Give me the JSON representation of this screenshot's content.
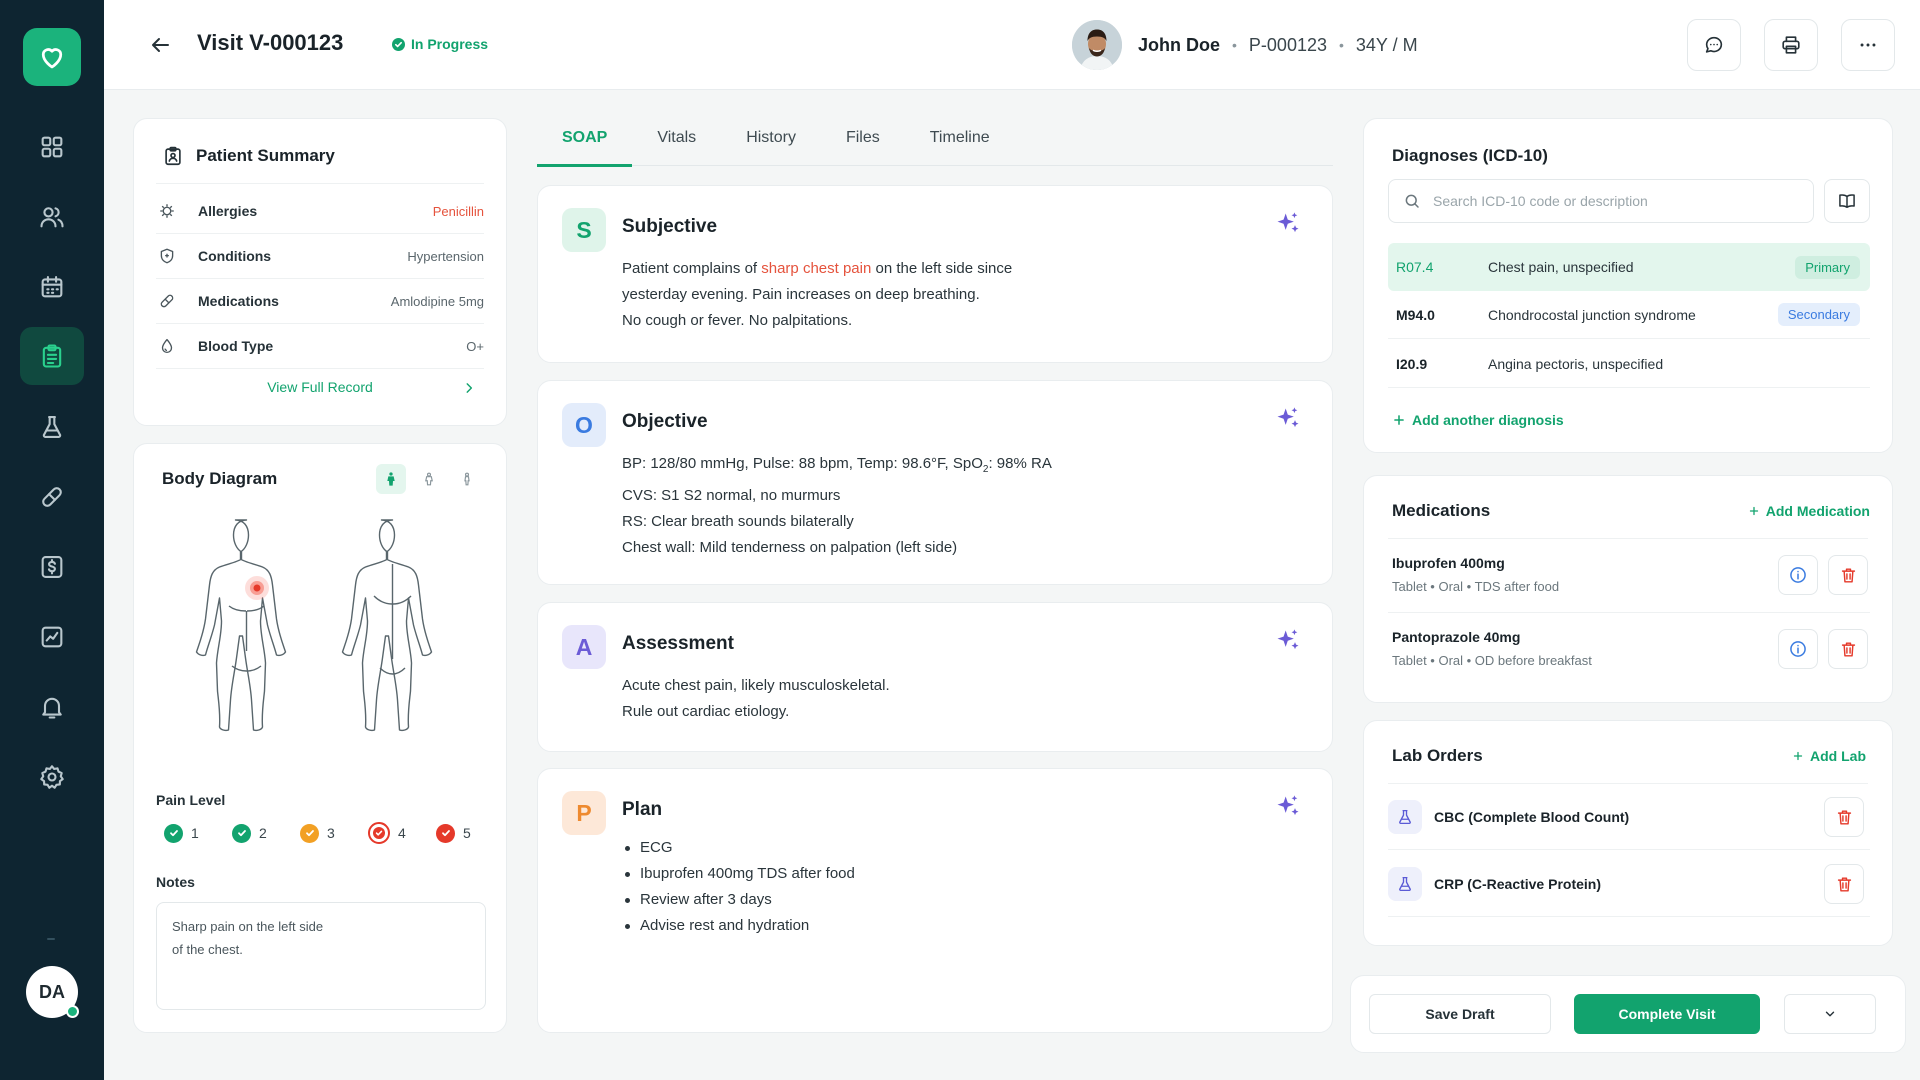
{
  "header": {
    "visit_title": "Visit V-000123",
    "status": "In Progress",
    "patient_name": "John Doe",
    "patient_id": "P-000123",
    "patient_age_sex": "34Y / M",
    "separator": "•"
  },
  "patient_summary": {
    "title": "Patient Summary",
    "rows": [
      {
        "label": "Allergies",
        "value": "Penicillin"
      },
      {
        "label": "Conditions",
        "value": "Hypertension"
      },
      {
        "label": "Medications",
        "value": "Amlodipine 5mg"
      },
      {
        "label": "Blood Type",
        "value": "O+"
      }
    ],
    "view_full": "View Full Record"
  },
  "body_diagram": {
    "title": "Body Diagram",
    "pain_title": "Pain Level",
    "pain_levels": [
      "1",
      "2",
      "3",
      "4",
      "5"
    ],
    "selected_pain": "4",
    "notes_title": "Notes",
    "notes": "Sharp pain on the left side\nof the chest."
  },
  "tabs": [
    "SOAP",
    "Vitals",
    "History",
    "Files",
    "Timeline"
  ],
  "active_tab": "SOAP",
  "soap": {
    "subjective": {
      "letter": "S",
      "title": "Subjective",
      "pre": "Patient complains of ",
      "highlight": "sharp chest pain",
      "post": " on the left side since",
      "line2": "yesterday evening. Pain increases on deep breathing.",
      "line3": "No cough or fever. No palpitations."
    },
    "objective": {
      "letter": "O",
      "title": "Objective",
      "vitals_pre": "BP: 128/80 mmHg, Pulse: 88 bpm, Temp: 98.6°F, SpO",
      "vitals_sub": "2",
      "vitals_post": ": 98% RA",
      "line2": "CVS: S1 S2 normal, no murmurs",
      "line3": "RS: Clear breath sounds bilaterally",
      "line4": "Chest wall: Mild tenderness on palpation (left side)"
    },
    "assessment": {
      "letter": "A",
      "title": "Assessment",
      "line1": "Acute chest pain, likely musculoskeletal.",
      "line2": "Rule out cardiac etiology."
    },
    "plan": {
      "letter": "P",
      "title": "Plan",
      "items": [
        "ECG",
        "Ibuprofen 400mg TDS after food",
        "Review after 3 days",
        "Advise rest and hydration"
      ]
    }
  },
  "diagnoses": {
    "title": "Diagnoses (ICD-10)",
    "search_placeholder": "Search ICD-10 code or description",
    "items": [
      {
        "code": "R07.4",
        "desc": "Chest pain, unspecified",
        "tag": "Primary"
      },
      {
        "code": "M94.0",
        "desc": "Chondrocostal junction syndrome",
        "tag": "Secondary"
      },
      {
        "code": "I20.9",
        "desc": "Angina pectoris, unspecified",
        "tag": ""
      }
    ],
    "add_label": "Add another diagnosis"
  },
  "medications": {
    "title": "Medications",
    "add_label": "Add Medication",
    "items": [
      {
        "name": "Ibuprofen 400mg",
        "detail": "Tablet • Oral • TDS after food"
      },
      {
        "name": "Pantoprazole 40mg",
        "detail": "Tablet • Oral • OD before breakfast"
      }
    ]
  },
  "lab_orders": {
    "title": "Lab Orders",
    "add_label": "Add Lab",
    "items": [
      {
        "name": "CBC (Complete Blood Count)"
      },
      {
        "name": "CRP (C-Reactive Protein)"
      }
    ]
  },
  "footer": {
    "save_draft": "Save Draft",
    "complete": "Complete Visit"
  },
  "user": {
    "initials": "DA"
  },
  "colors": {
    "accent": "#12a36e",
    "sidebar": "#0e2531",
    "danger": "#e5533d",
    "secondary": "#3a7be0"
  },
  "icons": [
    "heart-logo-icon",
    "dashboard-icon",
    "users-icon",
    "calendar-icon",
    "clipboard-icon",
    "flask-icon",
    "pill-icon",
    "dollar-icon",
    "chart-icon",
    "bell-icon",
    "gear-icon",
    "back-arrow-icon",
    "chat-icon",
    "printer-icon",
    "more-icon",
    "sparkle-icon",
    "search-icon",
    "book-icon",
    "info-icon",
    "trash-icon",
    "plus-icon",
    "chevron-down-icon"
  ]
}
